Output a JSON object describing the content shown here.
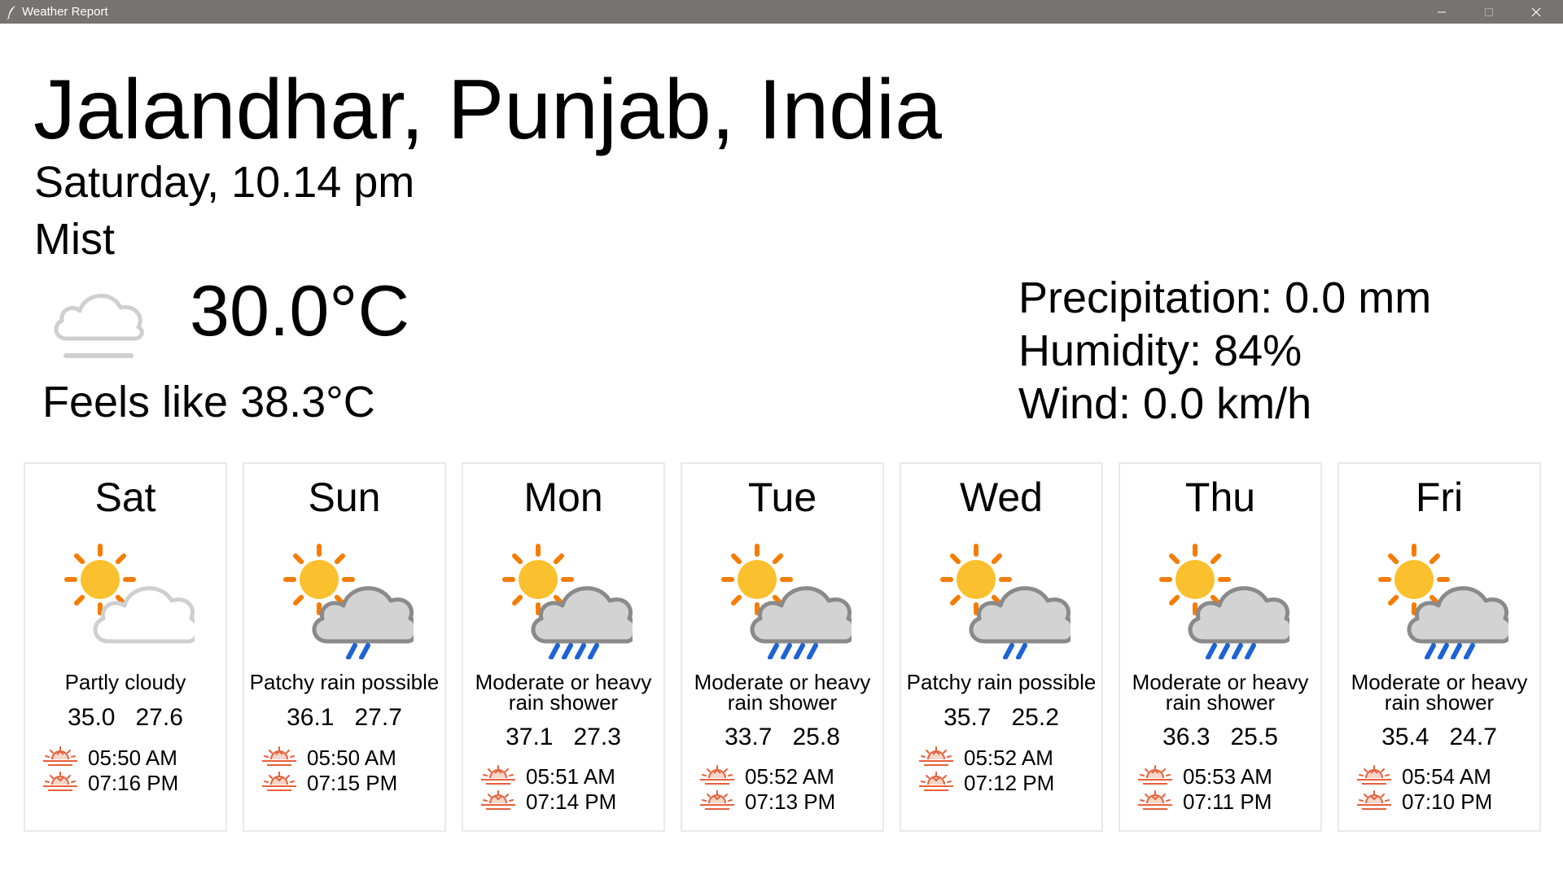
{
  "window": {
    "title": "Weather Report"
  },
  "current": {
    "location": "Jalandhar, Punjab, India",
    "datetime": "Saturday, 10.14 pm",
    "condition": "Mist",
    "temperature": "30.0°C",
    "feels_like": "Feels like 38.3°C",
    "icon": "mist-cloud-icon",
    "precipitation": "Precipitation: 0.0 mm",
    "humidity": "Humidity: 84%",
    "wind": "Wind: 0.0 km/h"
  },
  "colors": {
    "titlebar": "#787373",
    "card_border": "#e9e9e9",
    "sun": "#fbc02d",
    "sun_ray": "#f57c00",
    "rain": "#1e63d6",
    "sunrise_icon": "#e8603c"
  },
  "forecast": [
    {
      "day": "Sat",
      "icon": "partly-cloudy-icon",
      "desc": "Partly cloudy",
      "temps": "35.0   27.6",
      "sunrise": "05:50 AM",
      "sunset": "07:16 PM"
    },
    {
      "day": "Sun",
      "icon": "patchy-rain-icon",
      "desc": "Patchy rain possible",
      "temps": "36.1   27.7",
      "sunrise": "05:50 AM",
      "sunset": "07:15 PM"
    },
    {
      "day": "Mon",
      "icon": "heavy-rain-shower-icon",
      "desc": "Moderate or heavy rain shower",
      "temps": "37.1   27.3",
      "sunrise": "05:51 AM",
      "sunset": "07:14 PM"
    },
    {
      "day": "Tue",
      "icon": "heavy-rain-shower-icon",
      "desc": "Moderate or heavy rain shower",
      "temps": "33.7   25.8",
      "sunrise": "05:52 AM",
      "sunset": "07:13 PM"
    },
    {
      "day": "Wed",
      "icon": "patchy-rain-icon",
      "desc": "Patchy rain possible",
      "temps": "35.7   25.2",
      "sunrise": "05:52 AM",
      "sunset": "07:12 PM"
    },
    {
      "day": "Thu",
      "icon": "heavy-rain-shower-icon",
      "desc": "Moderate or heavy rain shower",
      "temps": "36.3   25.5",
      "sunrise": "05:53 AM",
      "sunset": "07:11 PM"
    },
    {
      "day": "Fri",
      "icon": "heavy-rain-shower-icon",
      "desc": "Moderate or heavy rain shower",
      "temps": "35.4   24.7",
      "sunrise": "05:54 AM",
      "sunset": "07:10 PM"
    }
  ]
}
